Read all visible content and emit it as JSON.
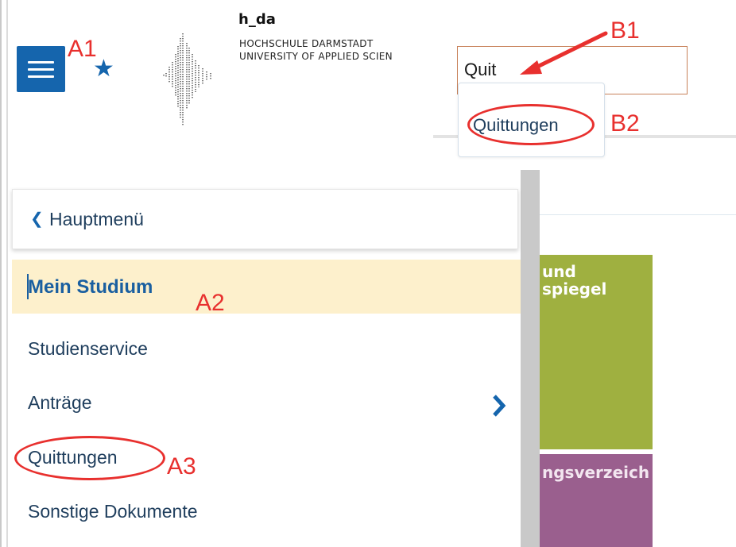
{
  "header": {
    "logo": {
      "title": "h_da",
      "line1": "HOCHSCHULE DARMSTADT",
      "line2": "UNIVERSITY OF APPLIED SCIEN"
    },
    "search": {
      "value": "Quit",
      "suggestion": "Quittungen"
    },
    "icons": {
      "menu": "hamburger-menu-icon",
      "favorite": "star-icon"
    }
  },
  "side_menu": {
    "back_label": "Hauptmenü",
    "active_item": "Mein Studium",
    "items": [
      {
        "label": "Studienservice"
      },
      {
        "label": "Anträge"
      },
      {
        "label": "Quittungen"
      },
      {
        "label": "Sonstige Dokumente"
      }
    ]
  },
  "tiles": [
    {
      "lines": [
        "und",
        "spiegel"
      ],
      "color": "#9fb040"
    },
    {
      "lines": [
        "ngsverzeich"
      ],
      "color": "#9a5f8e"
    }
  ],
  "annotations": {
    "a1": "A1",
    "a2": "A2",
    "a3": "A3",
    "b1": "B1",
    "b2": "B2",
    "color": "#e8302e"
  },
  "colors": {
    "primary": "#1565ad",
    "active_row": "#fdf0cc",
    "text": "#1f3e5d"
  }
}
